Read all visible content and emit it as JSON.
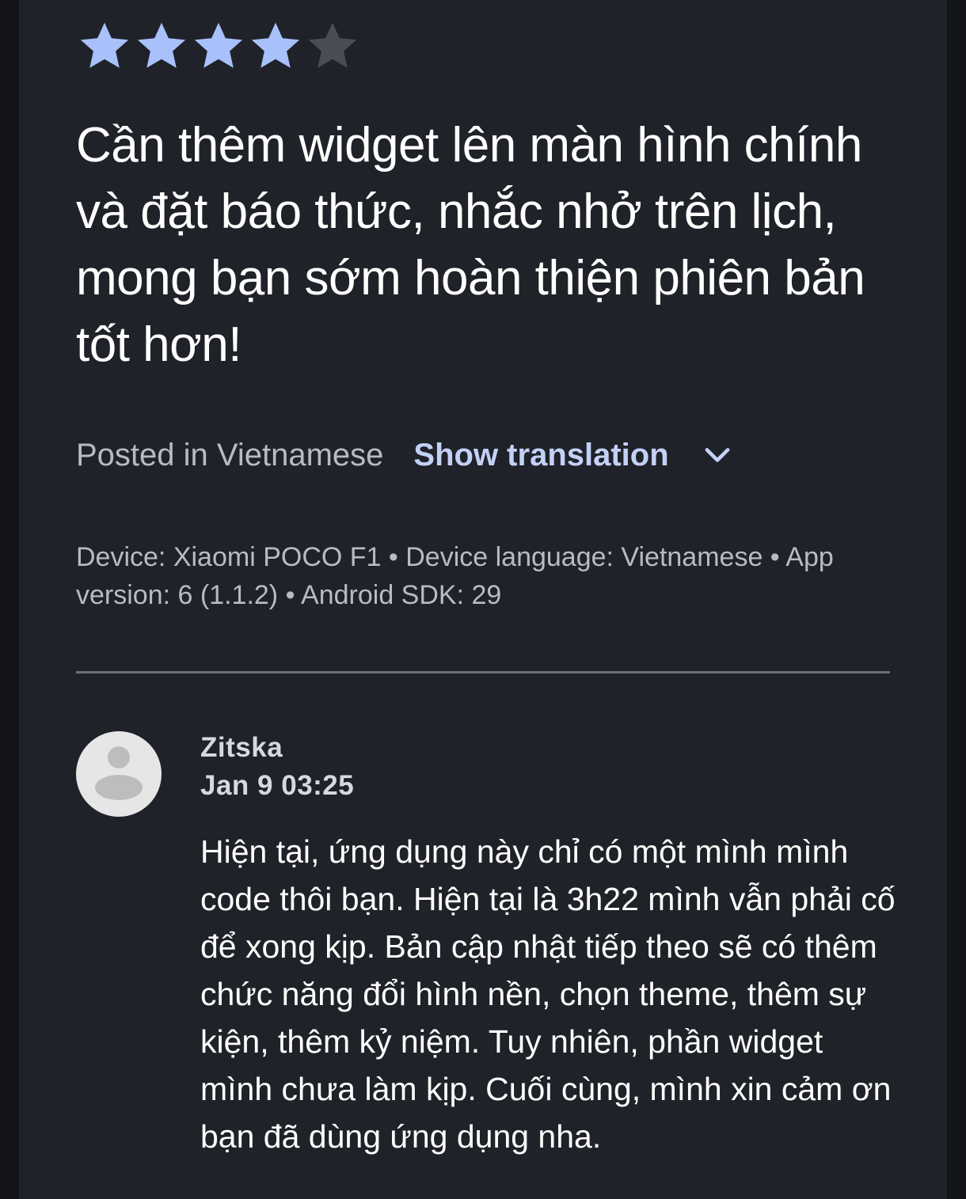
{
  "review": {
    "rating": 4,
    "max_rating": 5,
    "text": "Cần thêm widget lên màn hình chính và đặt báo thức, nhắc nhở trên lịch, mong bạn sớm hoàn thiện phiên bản tốt hơn!",
    "posted_in": "Posted in Vietnamese",
    "show_translation": "Show translation",
    "device_info": "Device: Xiaomi POCO F1 • Device language: Vietnamese • App version: 6 (1.1.2) • Android SDK: 29"
  },
  "reply": {
    "author": "Zitska",
    "date": "Jan 9 03:25",
    "text": "Hiện tại, ứng dụng này chỉ có một mình mình code thôi bạn. Hiện tại là 3h22 mình vẫn phải cố để xong kịp. Bản cập nhật tiếp theo sẽ có thêm chức năng đổi hình nền, chọn theme, thêm sự kiện, thêm kỷ niệm. Tuy nhiên, phần widget mình chưa làm kịp. Cuối cùng, mình xin cảm ơn bạn đã dùng ứng dụng nha."
  },
  "colors": {
    "star_filled": "#a8c1fb",
    "star_empty": "#4a4d55",
    "accent": "#c3d1f7",
    "background": "#202229"
  },
  "icons": {
    "star": "star-icon",
    "chevron": "chevron-down-icon",
    "avatar": "person-icon"
  }
}
